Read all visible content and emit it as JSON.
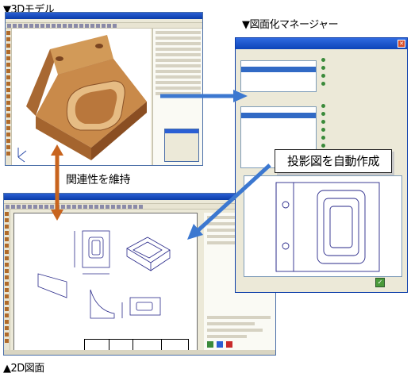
{
  "captions": {
    "model3d": "▼3Dモデル",
    "manager": "▼図面化マネージャー",
    "drawing2d": "▲2D図面",
    "relation": "関連性を維持",
    "callout": "投影図を自動作成"
  },
  "manager_dialog": {
    "close_glyph": "✕",
    "ok_glyph": "✓"
  },
  "colors": {
    "arrow_blue": "#3c78d0",
    "arrow_orange": "#c8641e",
    "model_brown": "#c98a4a"
  }
}
